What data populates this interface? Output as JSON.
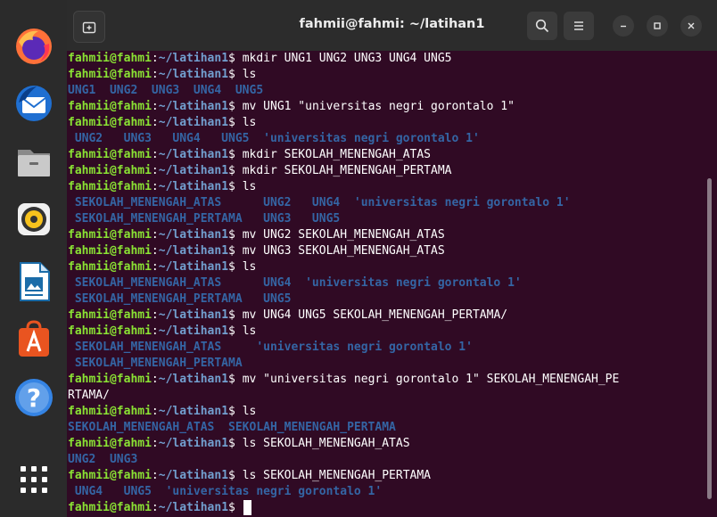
{
  "dock": {
    "items": [
      {
        "name": "firefox-icon",
        "label": "Firefox"
      },
      {
        "name": "thunderbird-icon",
        "label": "Thunderbird"
      },
      {
        "name": "files-icon",
        "label": "Files"
      },
      {
        "name": "rhythmbox-icon",
        "label": "Rhythmbox"
      },
      {
        "name": "libreoffice-writer-icon",
        "label": "LibreOffice Writer"
      },
      {
        "name": "app-center-icon",
        "label": "App Center"
      },
      {
        "name": "help-icon",
        "label": "Help"
      },
      {
        "name": "show-apps-icon",
        "label": "Show Applications"
      }
    ]
  },
  "window": {
    "title": "fahmii@fahmi: ~/latihan1",
    "buttons": [
      "new-tab-icon",
      "search-icon",
      "menu-icon",
      "minimize-icon",
      "maximize-icon",
      "close-icon"
    ]
  },
  "prompt": {
    "user": "fahmii@fahmi",
    "sep": ":",
    "path": "~/latihan1",
    "dollar": "$ "
  },
  "colors": {
    "background": "#300a24",
    "prompt_user": "#8ae234",
    "prompt_path": "#729fcf",
    "directory": "#3465a4"
  },
  "terminal": {
    "lines": [
      {
        "type": "prompt",
        "cmd": "mkdir UNG1 UNG2 UNG3 UNG4 UNG5"
      },
      {
        "type": "prompt",
        "cmd": "ls"
      },
      {
        "type": "output",
        "text": "UNG1  UNG2  UNG3  UNG4  UNG5"
      },
      {
        "type": "prompt",
        "cmd": "mv UNG1 \"universitas negri gorontalo 1\""
      },
      {
        "type": "prompt",
        "cmd": "ls"
      },
      {
        "type": "output",
        "text": " UNG2   UNG3   UNG4   UNG5  'universitas negri gorontalo 1'"
      },
      {
        "type": "prompt",
        "cmd": "mkdir SEKOLAH_MENENGAH_ATAS"
      },
      {
        "type": "prompt",
        "cmd": "mkdir SEKOLAH_MENENGAH_PERTAMA"
      },
      {
        "type": "prompt",
        "cmd": "ls"
      },
      {
        "type": "output",
        "text": " SEKOLAH_MENENGAH_ATAS      UNG2   UNG4  'universitas negri gorontalo 1'"
      },
      {
        "type": "output",
        "text": " SEKOLAH_MENENGAH_PERTAMA   UNG3   UNG5"
      },
      {
        "type": "prompt",
        "cmd": "mv UNG2 SEKOLAH_MENENGAH_ATAS"
      },
      {
        "type": "prompt",
        "cmd": "mv UNG3 SEKOLAH_MENENGAH_ATAS"
      },
      {
        "type": "prompt",
        "cmd": "ls"
      },
      {
        "type": "output",
        "text": " SEKOLAH_MENENGAH_ATAS      UNG4  'universitas negri gorontalo 1'"
      },
      {
        "type": "output",
        "text": " SEKOLAH_MENENGAH_PERTAMA   UNG5"
      },
      {
        "type": "prompt",
        "cmd": "mv UNG4 UNG5 SEKOLAH_MENENGAH_PERTAMA/"
      },
      {
        "type": "prompt",
        "cmd": "ls"
      },
      {
        "type": "output",
        "text": " SEKOLAH_MENENGAH_ATAS     'universitas negri gorontalo 1'"
      },
      {
        "type": "output",
        "text": " SEKOLAH_MENENGAH_PERTAMA"
      },
      {
        "type": "prompt",
        "cmd": "mv \"universitas negri gorontalo 1\" SEKOLAH_MENENGAH_PE"
      },
      {
        "type": "plain",
        "text": "RTAMA/"
      },
      {
        "type": "prompt",
        "cmd": "ls"
      },
      {
        "type": "output",
        "text": "SEKOLAH_MENENGAH_ATAS  SEKOLAH_MENENGAH_PERTAMA"
      },
      {
        "type": "prompt",
        "cmd": "ls SEKOLAH_MENENGAH_ATAS"
      },
      {
        "type": "output",
        "text": "UNG2  UNG3"
      },
      {
        "type": "prompt",
        "cmd": "ls SEKOLAH_MENENGAH_PERTAMA"
      },
      {
        "type": "output",
        "text": " UNG4   UNG5  'universitas negri gorontalo 1'"
      },
      {
        "type": "prompt",
        "cmd": "",
        "cursor": true
      }
    ]
  }
}
